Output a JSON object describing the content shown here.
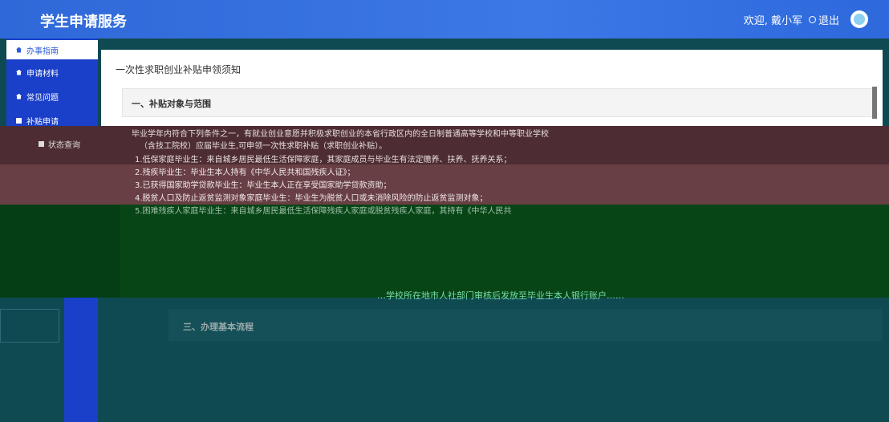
{
  "header": {
    "app_title": "学生申请服务",
    "welcome": "欢迎, 戴小军",
    "logout": "退出"
  },
  "sidebar": {
    "items": [
      {
        "label": "办事指南",
        "icon": "home-icon",
        "active": true
      },
      {
        "label": "申请材料",
        "icon": "home-icon",
        "active": false
      },
      {
        "label": "常见问题",
        "icon": "home-icon",
        "active": false
      },
      {
        "label": "补贴申请",
        "icon": "document-icon",
        "active": false
      },
      {
        "label": "状态查询",
        "icon": "document-icon",
        "active": false
      }
    ]
  },
  "main": {
    "page_heading": "一次性求职创业补贴申领须知",
    "section1_title": "一、补贴对象与范围",
    "body_lines": [
      "毕业学年内符合下列条件之一，有就业创业意愿并积极求职创业的本省行政区内的全日制普通高等学校和中等职业学校",
      "（含技工院校）应届毕业生,可申领一次性求职补贴（求职创业补贴）。",
      "1.低保家庭毕业生：来自城乡居民最低生活保障家庭，其家庭成员与毕业生有法定赡养、扶养、抚养关系；",
      "2.残疾毕业生：毕业生本人持有《中华人民共和国残疾人证》；",
      "3.已获得国家助学贷款毕业生：毕业生本人正在享受国家助学贷款资助；",
      "4.脱贫人口及防止返贫监测对象家庭毕业生：毕业生为脱贫人口或未消除风险的防止返贫监测对象；",
      "5.困难残疾人家庭毕业生：来自城乡居民最低生活保障残疾人家庭或脱贫残疾人家庭，其持有《中华人民共"
    ],
    "section3_title": "三、办理基本流程",
    "faded_line": "…学校所在地市人社部门审核后发放至毕业生本人银行账户……"
  }
}
